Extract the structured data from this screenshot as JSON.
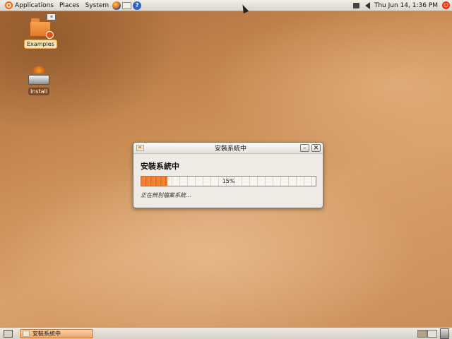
{
  "top_panel": {
    "menus": [
      "Applications",
      "Places",
      "System"
    ],
    "launchers": [
      "firefox-icon",
      "mail-icon",
      "help-icon"
    ],
    "clock": "Thu Jun 14,  1:36 PM"
  },
  "desktop_icons": [
    {
      "label": "Examples",
      "icon": "folder-icon",
      "selected": true
    },
    {
      "label": "Install",
      "icon": "installer-icon",
      "selected": false
    }
  ],
  "dialog": {
    "title": "安裝系統中",
    "heading": "安裝系統中",
    "progress_percent": 15,
    "progress_text": "15%",
    "status": "正在辨別檔案系統..."
  },
  "bottom_panel": {
    "task_label": "安裝系統中"
  },
  "colors": {
    "accent": "#e96a14",
    "progress": "#ef7a2a"
  }
}
